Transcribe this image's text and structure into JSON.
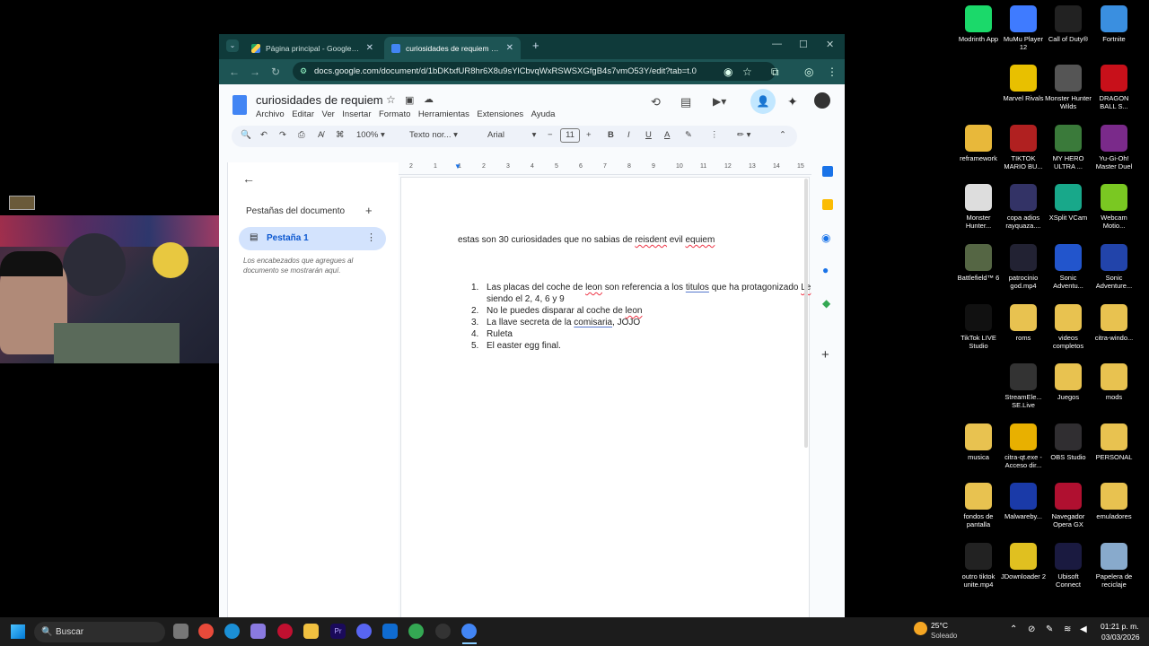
{
  "browser": {
    "tabs": [
      {
        "title": "Página principal - Google Drive",
        "active": false
      },
      {
        "title": "curiosidades de requiem - Docs",
        "active": true
      }
    ],
    "url": "docs.google.com/document/d/1bDKtxfUR8hr6X8u9sYlCbvqWxRSWSXGfgB4s7vmO53Y/edit?tab=t.0"
  },
  "docs": {
    "title": "curiosidades de requiem",
    "menu": [
      "Archivo",
      "Editar",
      "Ver",
      "Insertar",
      "Formato",
      "Herramientas",
      "Extensiones",
      "Ayuda"
    ],
    "toolbar": {
      "zoom": "100%",
      "style": "Texto nor...",
      "font": "Arial",
      "size": "11"
    },
    "sidepanel": {
      "heading": "Pestañas del documento",
      "tab_label": "Pestaña 1",
      "hint": "Los encabezados que agregues al documento se mostrarán aquí."
    },
    "body": {
      "intro_a": "estas son 30 curiosidades que no sabias de ",
      "intro_b": "reisdent",
      "intro_c": " evil ",
      "intro_d": "equiem",
      "list": [
        {
          "num": "1.",
          "a": "Las placas del coche de ",
          "b": "leon",
          "c": " son referencia a los ",
          "d": "titulos",
          "e": " que ha protagonizado ",
          "f": "Le"
        },
        {
          "num": "",
          "a": "siendo el 2, 4, 6 y 9"
        },
        {
          "num": "2.",
          "a": "No le puedes disparar al coche de ",
          "b": "leon"
        },
        {
          "num": "3.",
          "a": "La llave secreta de la ",
          "b": "comisaria",
          "c": ", JOJO"
        },
        {
          "num": "4.",
          "a": "Ruleta"
        },
        {
          "num": "5.",
          "a": "El easter egg final."
        }
      ]
    },
    "ruler_numbers": [
      "2",
      "1",
      "1",
      "2",
      "3",
      "4",
      "5",
      "6",
      "7",
      "8",
      "9",
      "10",
      "11",
      "12",
      "13",
      "14",
      "15"
    ]
  },
  "desktop_icons": [
    {
      "label": "Modrinth App",
      "color": "#1bd96a"
    },
    {
      "label": "MuMu Player 12",
      "color": "#3f7bff"
    },
    {
      "label": "Call of Duty®",
      "color": "#222222"
    },
    {
      "label": "Fortnite",
      "color": "#3a8fe0"
    },
    {
      "label": "Marvel Rivals",
      "color": "#e8c000"
    },
    {
      "label": "Monster Hunter Wilds",
      "color": "#555555"
    },
    {
      "label": "DRAGON BALL S...",
      "color": "#c8101a"
    },
    {
      "label": "reframework",
      "color": "#e8b83a"
    },
    {
      "label": "TIKTOK MARIO BU...",
      "color": "#b02020"
    },
    {
      "label": "MY HERO ULTRA ...",
      "color": "#3a7a3a"
    },
    {
      "label": "Yu-Gi-Oh! Master Duel",
      "color": "#7a2a8a"
    },
    {
      "label": "Monster Hunter...",
      "color": "#dddddd"
    },
    {
      "label": "copa adios rayquaza....",
      "color": "#333366"
    },
    {
      "label": "XSplit VCam",
      "color": "#18a88a"
    },
    {
      "label": "Webcam Motio...",
      "color": "#7ac822"
    },
    {
      "label": "Battlefield™ 6",
      "color": "#556644"
    },
    {
      "label": "patrocinio god.mp4",
      "color": "#222233"
    },
    {
      "label": "Sonic Adventu...",
      "color": "#2255cc"
    },
    {
      "label": "Sonic Adventure...",
      "color": "#2244aa"
    },
    {
      "label": "TikTok LIVE Studio",
      "color": "#111111"
    },
    {
      "label": "roms",
      "color": "#e8c250"
    },
    {
      "label": "videos completos",
      "color": "#e8c250"
    },
    {
      "label": "citra-windo...",
      "color": "#e8c250"
    },
    {
      "label": "StreamEle... SE.Live",
      "color": "#333333"
    },
    {
      "label": "Juegos",
      "color": "#e8c250"
    },
    {
      "label": "mods",
      "color": "#e8c250"
    },
    {
      "label": "musica",
      "color": "#e8c250"
    },
    {
      "label": "citra-qt.exe - Acceso dir...",
      "color": "#e8b000"
    },
    {
      "label": "OBS Studio",
      "color": "#302e31"
    },
    {
      "label": "PERSONAL",
      "color": "#e8c250"
    },
    {
      "label": "fondos de pantalla",
      "color": "#e8c250"
    },
    {
      "label": "Malwareby...",
      "color": "#1a3aa8"
    },
    {
      "label": "Navegador Opera GX",
      "color": "#b01030"
    },
    {
      "label": "emuladores",
      "color": "#e8c250"
    },
    {
      "label": "outro tiktok unite.mp4",
      "color": "#222222"
    },
    {
      "label": "JDownloader 2",
      "color": "#e0c020"
    },
    {
      "label": "Ubisoft Connect",
      "color": "#1a1a40"
    },
    {
      "label": "Papelera de reciclaje",
      "color": "#88aacc"
    }
  ],
  "taskbar": {
    "search": "Buscar",
    "weather_temp": "25°C",
    "weather_desc": "Soleado",
    "time": "01:21 p. m.",
    "date": "03/03/2026"
  }
}
